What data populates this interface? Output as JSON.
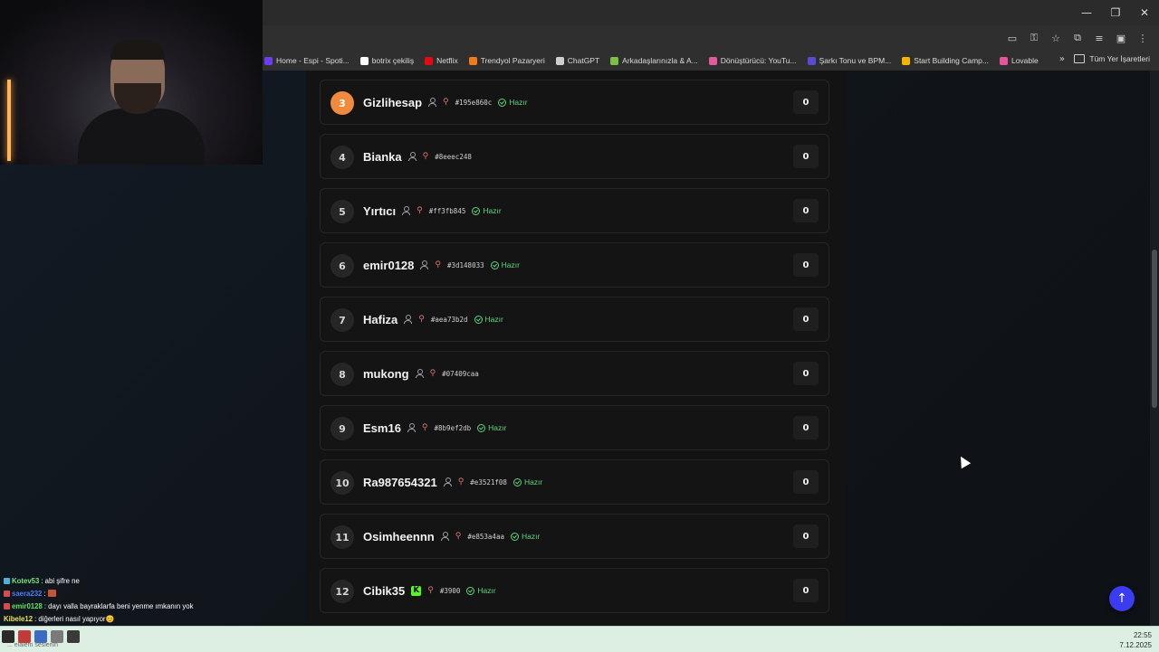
{
  "browser": {
    "window_buttons": [
      "—",
      "❐",
      "✕"
    ],
    "bookmarks": [
      {
        "label": "Home - Espi - Spoti...",
        "color": "#6a3df0"
      },
      {
        "label": "botrix çekiliş",
        "color": "#ffffff"
      },
      {
        "label": "Netflix",
        "color": "#e50914"
      },
      {
        "label": "Trendyol Pazaryeri",
        "color": "#f27a1a"
      },
      {
        "label": "ChatGPT",
        "color": "#cfcfcf"
      },
      {
        "label": "Arkadaşlarınızla & A...",
        "color": "#7bc043"
      },
      {
        "label": "Dönüştürücü: YouTu...",
        "color": "#e05a9d"
      },
      {
        "label": "Şarkı Tonu ve BPM...",
        "color": "#5a4ad1"
      },
      {
        "label": "Start Building Camp...",
        "color": "#f4b400"
      },
      {
        "label": "Lovable",
        "color": "#e8559b"
      }
    ],
    "bookmarks_more": "»",
    "all_bookmarks": "Tüm Yer İşaretleri"
  },
  "leaderboard": [
    {
      "rank": "3",
      "name": "Gizlihesap",
      "hash": "#195e860c",
      "status": "Hazır",
      "score": "0",
      "highlight": true
    },
    {
      "rank": "4",
      "name": "Bianka",
      "hash": "#8eeec248",
      "status": "",
      "score": "0"
    },
    {
      "rank": "5",
      "name": "Yırtıcı",
      "hash": "#ff3fb845",
      "status": "Hazır",
      "score": "0"
    },
    {
      "rank": "6",
      "name": "emir0128",
      "hash": "#3d148033",
      "status": "Hazır",
      "score": "0"
    },
    {
      "rank": "7",
      "name": "Hafiza",
      "hash": "#aea73b2d",
      "status": "Hazır",
      "score": "0"
    },
    {
      "rank": "8",
      "name": "mukong",
      "hash": "#07409caa",
      "status": "",
      "score": "0"
    },
    {
      "rank": "9",
      "name": "Esm16",
      "hash": "#8b9ef2db",
      "status": "Hazır",
      "score": "0"
    },
    {
      "rank": "10",
      "name": "Ra987654321",
      "hash": "#e3521f08",
      "status": "Hazır",
      "score": "0"
    },
    {
      "rank": "11",
      "name": "Osimheennn",
      "hash": "#e853a4aa",
      "status": "Hazır",
      "score": "0"
    },
    {
      "rank": "12",
      "name": "Cibik35",
      "hash": "#3900",
      "status": "Hazır",
      "score": "0",
      "kick": true
    }
  ],
  "scroll_top_label": "↑",
  "chat": [
    {
      "user": "Kotev53",
      "user_color": "#7be37b",
      "msg": ": abi şifre ne",
      "badge": "#4fb0d8"
    },
    {
      "user": "saera232",
      "user_color": "#4a7bff",
      "msg": ": ",
      "badge": "#d94a4a",
      "emote": true
    },
    {
      "user": "emir0128",
      "user_color": "#5fe35f",
      "msg": ": dayı valla bayraklarfa beni yenme ımkanın yok",
      "badge": "#d94a4a"
    },
    {
      "user": "Kibele12",
      "user_color": "#e8e84a",
      "msg": ": diğerleri nasıl yapıyor😊",
      "badge": ""
    }
  ],
  "taskbar": {
    "clock_time": "22:55",
    "clock_date": "7.12.2025",
    "ticker": "... elalem seslenin"
  }
}
